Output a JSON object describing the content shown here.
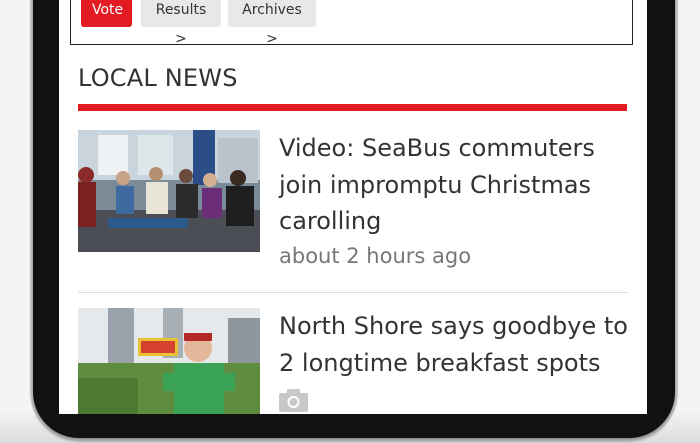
{
  "poll": {
    "vote_label": "Vote",
    "results_label": "Results >",
    "archives_label": "Archives >"
  },
  "section": {
    "title": "LOCAL NEWS"
  },
  "stories": [
    {
      "headline": "Video: SeaBus commuters join impromptu Christmas carolling",
      "time": "about 2 hours ago",
      "thumb_icon": "seabus-commuters-photo"
    },
    {
      "headline": "North Shore says goodbye to 2 longtime breakfast spots",
      "thumb_icon": "breakfast-spot-photo",
      "media_icon": "camera-icon"
    }
  ],
  "colors": {
    "accent": "#e31b23",
    "text": "#333333",
    "muted": "#777777"
  }
}
